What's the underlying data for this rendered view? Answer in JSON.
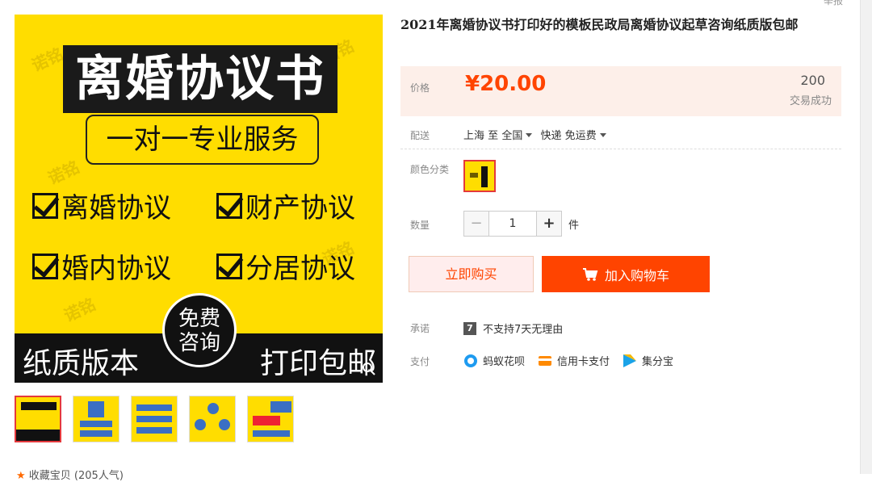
{
  "header": {
    "report_label": "举报"
  },
  "gallery": {
    "main_title": "离婚协议书",
    "service": "一对一专业服务",
    "features": [
      "离婚协议",
      "财产协议",
      "婚内协议",
      "分居协议"
    ],
    "free_badge": [
      "免费",
      "咨询"
    ],
    "bottom_left": "纸质版本",
    "bottom_right": "打印包邮",
    "watermark": "诺铭",
    "thumbnail_count": 5
  },
  "favorite": {
    "label": "收藏宝贝 (205人气)"
  },
  "product": {
    "title": "2021年离婚协议书打印好的模板民政局离婚协议起草咨询纸质版包邮",
    "price_label": "价格",
    "price": "¥20.00",
    "sales_count": "200",
    "sales_label": "交易成功",
    "shipping_label": "配送",
    "ship_from": "上海",
    "ship_to_word": "至",
    "ship_to": "全国",
    "ship_method": "快递 免运费",
    "color_label": "颜色分类",
    "qty_label": "数量",
    "qty_minus": "−",
    "qty_value": "1",
    "qty_plus": "+",
    "qty_unit": "件",
    "buy_now": "立即购买",
    "add_cart": "加入购物车",
    "promise_label": "承诺",
    "promise_badge": "7",
    "promise_text": "不支持7天无理由",
    "pay_label": "支付",
    "pay_methods": [
      "蚂蚁花呗",
      "信用卡支付",
      "集分宝"
    ]
  },
  "colors": {
    "accent": "#ff4400",
    "price_bg": "#fdefe9",
    "banner_yellow": "#ffdd00"
  }
}
